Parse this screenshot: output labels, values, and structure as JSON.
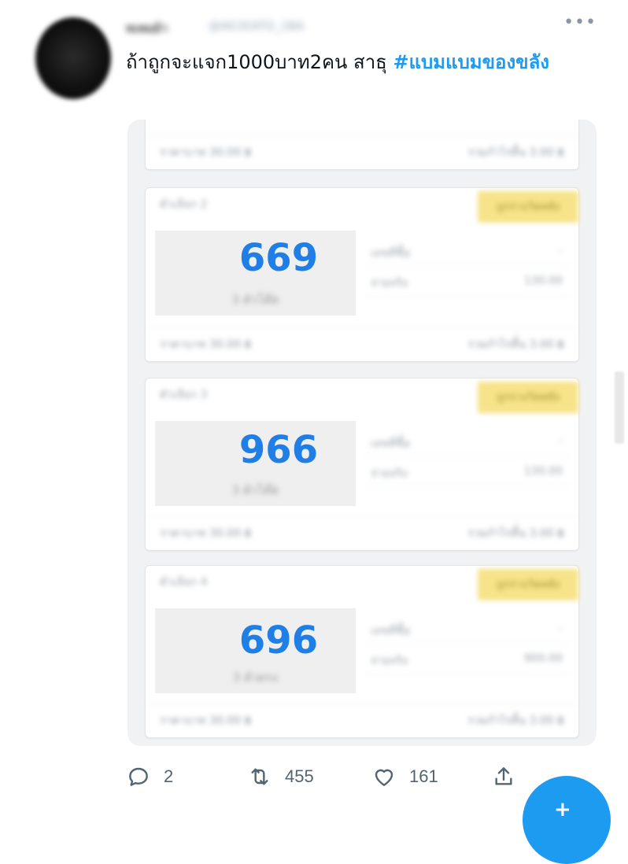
{
  "author": {
    "name": "ทเหมม้า",
    "handle": "@AE2EATO_1BA"
  },
  "tweet": {
    "text": "ถ้าถูกจะแจก1000บาท2คน สาธุ ",
    "hashtag": "#แบมแบมของขลัง"
  },
  "media": {
    "top_card": {
      "footer_left": "ราคาบาท 30.00 ฿",
      "footer_right": "รวมกำไรสิ้น 3.00 ฿"
    },
    "cards": [
      {
        "set_label": "ตัวเลือก 2",
        "badge": "ถูกรางวัลหลัง",
        "number": "669",
        "number_sub": "3 ตัวโต๊ด",
        "row1_key": "เลขที่ซื้อ",
        "row1_val": "-",
        "row2_key": "จ่ายจริง",
        "row2_val": "130.00",
        "footer_left": "ราคาบาท 30.00 ฿",
        "footer_right": "รวมกำไรสิ้น 3.00 ฿"
      },
      {
        "set_label": "ตัวเลือก 3",
        "badge": "ถูกรางวัลหลัง",
        "number": "966",
        "number_sub": "3 ตัวโต๊ด",
        "row1_key": "เลขที่ซื้อ",
        "row1_val": "-",
        "row2_key": "จ่ายจริง",
        "row2_val": "130.00",
        "footer_left": "ราคาบาท 30.00 ฿",
        "footer_right": "รวมกำไรสิ้น 3.00 ฿"
      },
      {
        "set_label": "ตัวเลือก 4",
        "badge": "ถูกรางวัลหลัง",
        "number": "696",
        "number_sub": "3 ตัวตรง",
        "row1_key": "เลขที่ซื้อ",
        "row1_val": "-",
        "row2_key": "จ่ายจริง",
        "row2_val": "900.00",
        "footer_left": "ราคาบาท 30.00 ฿",
        "footer_right": "รวมกำไรสิ้น 3.00 ฿"
      }
    ]
  },
  "actions": {
    "replies": "2",
    "retweets": "455",
    "likes": "161"
  },
  "colors": {
    "accent": "#1d9bf0",
    "number": "#1f7fe6",
    "badge": "#f7e389"
  },
  "icons": [
    "more-icon",
    "reply-icon",
    "retweet-icon",
    "like-icon",
    "share-icon",
    "compose-icon"
  ]
}
